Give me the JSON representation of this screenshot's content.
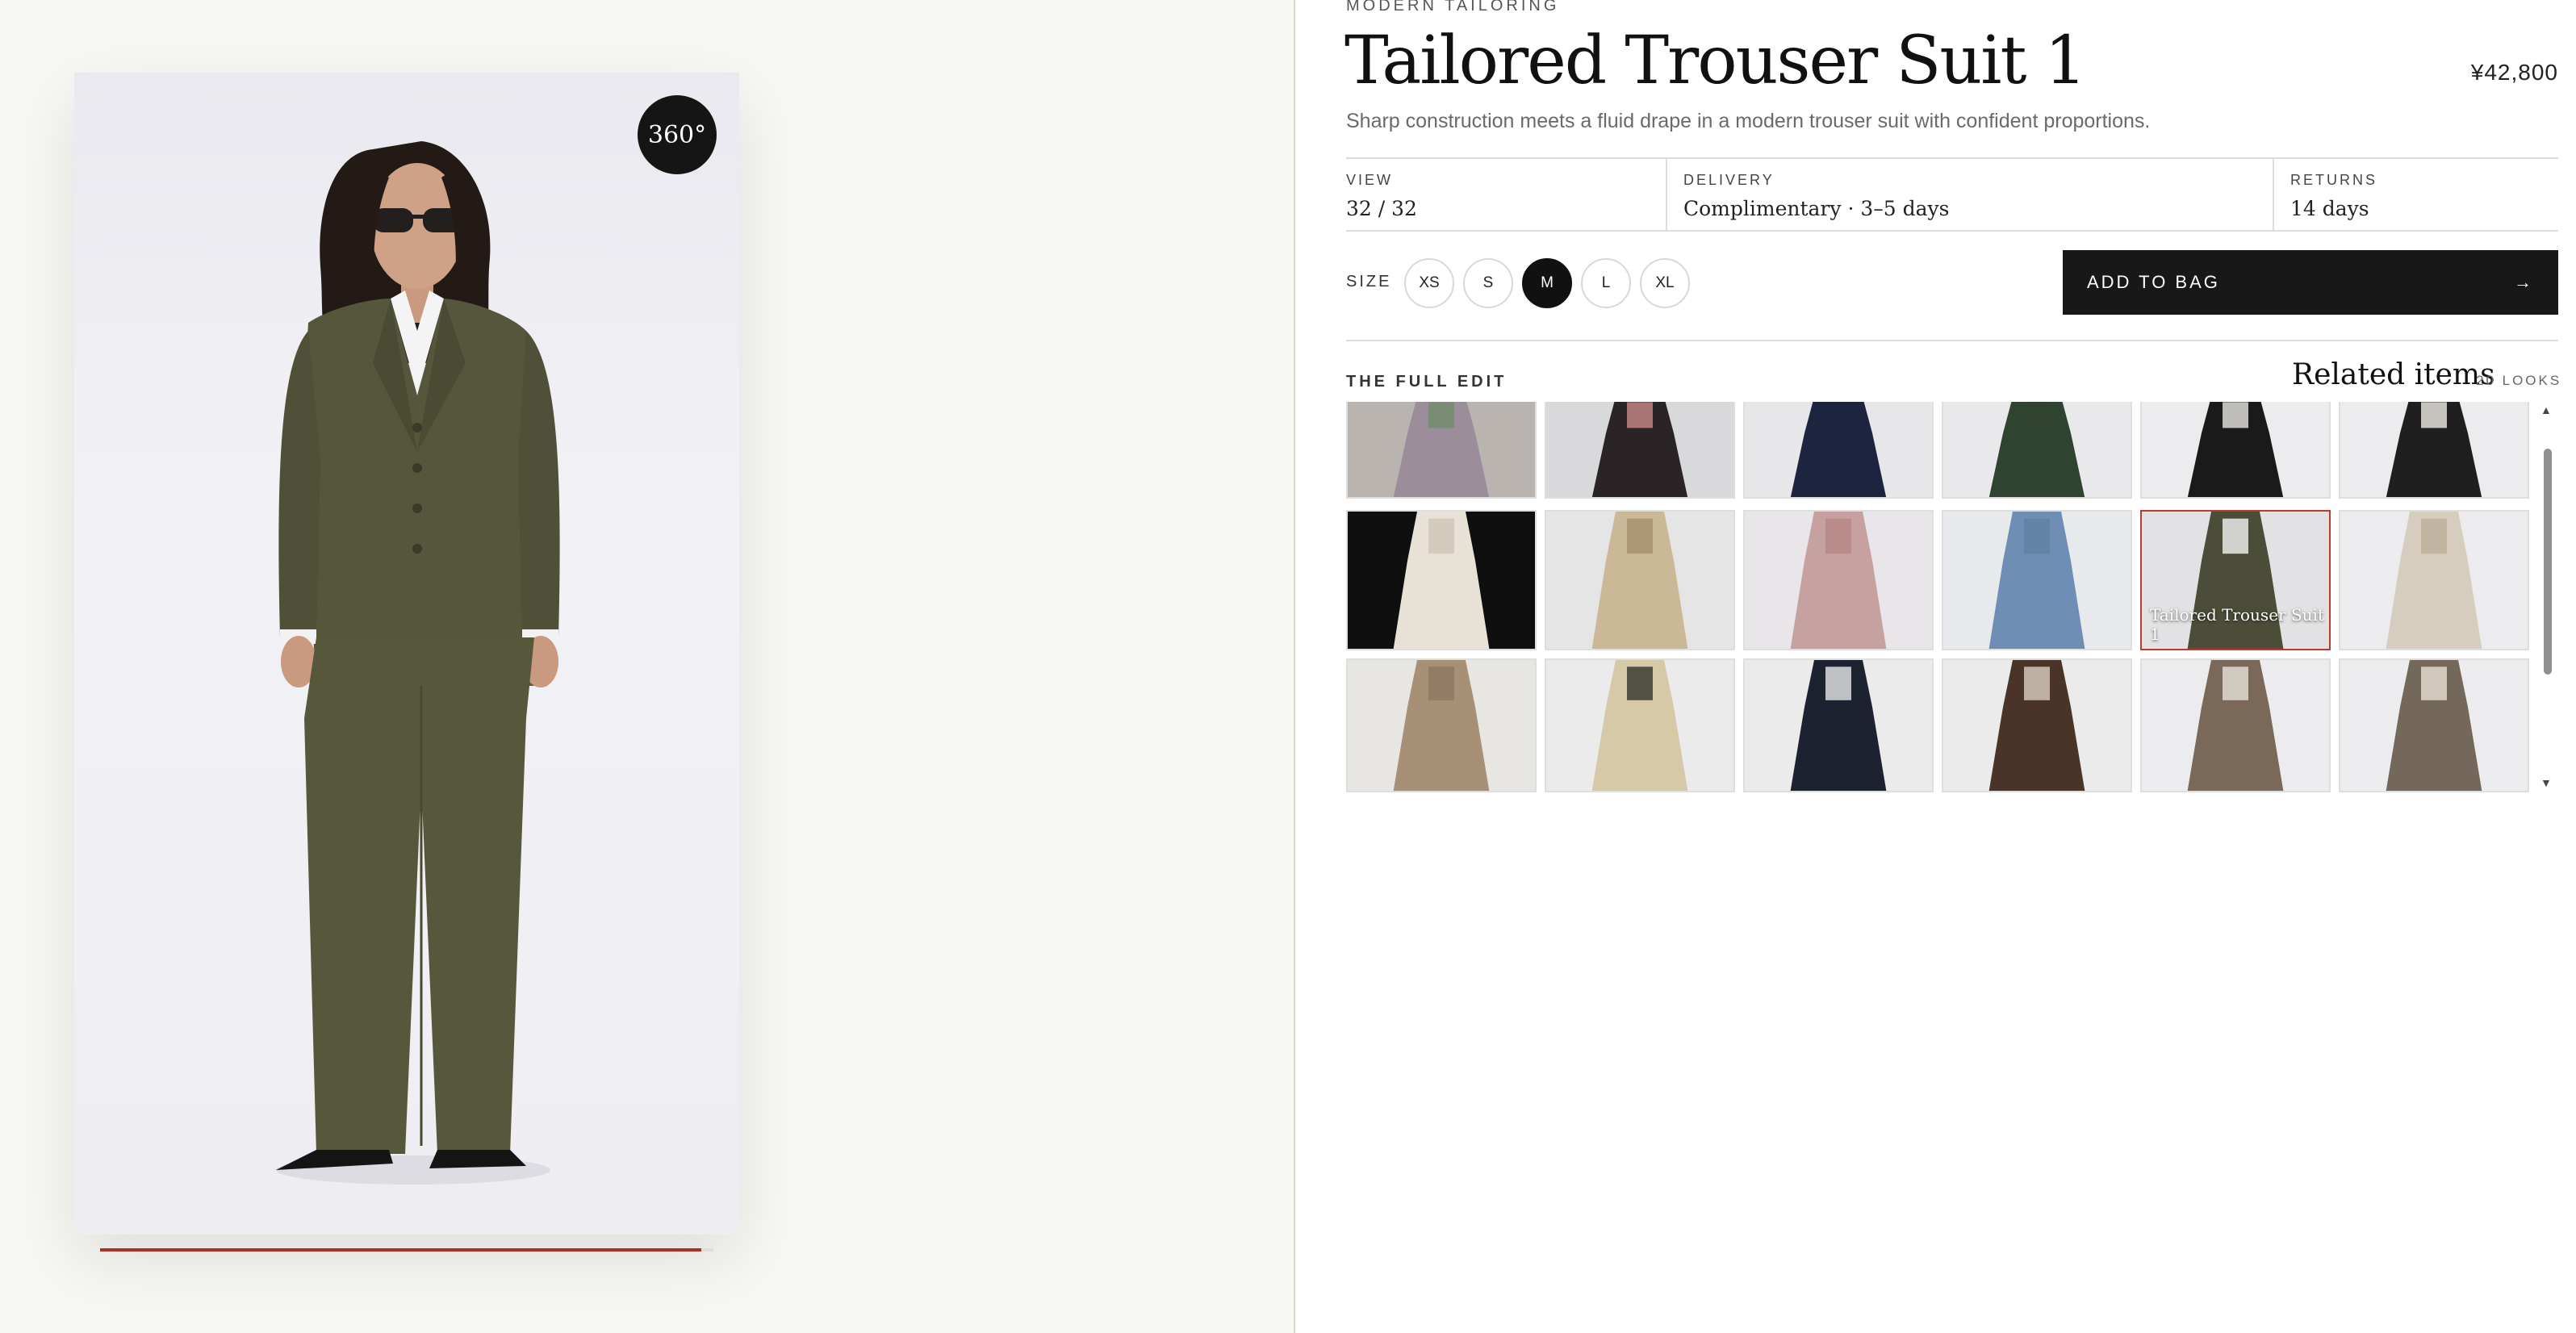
{
  "viewer": {
    "badge": "360°",
    "progress": 0.98
  },
  "product": {
    "eyebrow": "MODERN TAILORING",
    "title": "Tailored Trouser Suit 1",
    "price": "¥42,800",
    "description": "Sharp construction meets a fluid drape in a modern trouser suit with confident proportions."
  },
  "info": [
    {
      "label": "VIEW",
      "value": "32 / 32"
    },
    {
      "label": "DELIVERY",
      "value": "Complimentary · 3–5 days"
    },
    {
      "label": "RETURNS",
      "value": "14 days"
    }
  ],
  "size": {
    "label": "SIZE",
    "options": [
      "XS",
      "S",
      "M",
      "L",
      "XL"
    ],
    "selected": "M"
  },
  "cta": {
    "label": "ADD TO BAG",
    "icon": "arrow-right-icon"
  },
  "related": {
    "eyebrow": "THE FULL EDIT",
    "title": "Related items",
    "count": "20 LOOKS",
    "selected_caption": "Tailored Trouser Suit 1",
    "tiles": [
      {
        "bg": "#b9b4b0",
        "garment": "#9b8d9a",
        "accent": "#6f8d6a"
      },
      {
        "bg": "#d9d9dc",
        "garment": "#2b2426",
        "accent": "#c98a86"
      },
      {
        "bg": "#e7e7ea",
        "garment": "#1d2440",
        "accent": "#1d2440"
      },
      {
        "bg": "#e9e9ec",
        "garment": "#2f4430",
        "accent": "#2f4430"
      },
      {
        "bg": "#ececee",
        "garment": "#1a1a1a",
        "accent": "#e8e6e2"
      },
      {
        "bg": "#ececee",
        "garment": "#1f1f1f",
        "accent": "#f0ece6"
      },
      {
        "bg": "#0f0f10",
        "garment": "#e8e2d6",
        "accent": "#cfc6b5"
      },
      {
        "bg": "#e6e5e6",
        "garment": "#cbb896",
        "accent": "#a89070"
      },
      {
        "bg": "#e8e6e8",
        "garment": "#c7a19f",
        "accent": "#b58784"
      },
      {
        "bg": "#e8e9ec",
        "garment": "#6e8fb3",
        "accent": "#5f7fa3"
      },
      {
        "bg": "#e2e2e4",
        "garment": "#4c4d38",
        "accent": "#f2f2f2"
      },
      {
        "bg": "#ececee",
        "garment": "#d7cdbf",
        "accent": "#bcae9a"
      },
      {
        "bg": "#e8e6e3",
        "garment": "#a89077",
        "accent": "#8d7762"
      },
      {
        "bg": "#ebebec",
        "garment": "#d6c9a8",
        "accent": "#2f3527"
      },
      {
        "bg": "#ebebec",
        "garment": "#1c2230",
        "accent": "#e9e9e9"
      },
      {
        "bg": "#ebebec",
        "garment": "#4a3428",
        "accent": "#d9cfc0"
      },
      {
        "bg": "#ececee",
        "garment": "#7a6858",
        "accent": "#e7e2d8"
      },
      {
        "bg": "#ececee",
        "garment": "#74685a",
        "accent": "#e6e0d3"
      }
    ]
  },
  "colors": {
    "accent_red": "#a8322a",
    "ink": "#181818"
  }
}
